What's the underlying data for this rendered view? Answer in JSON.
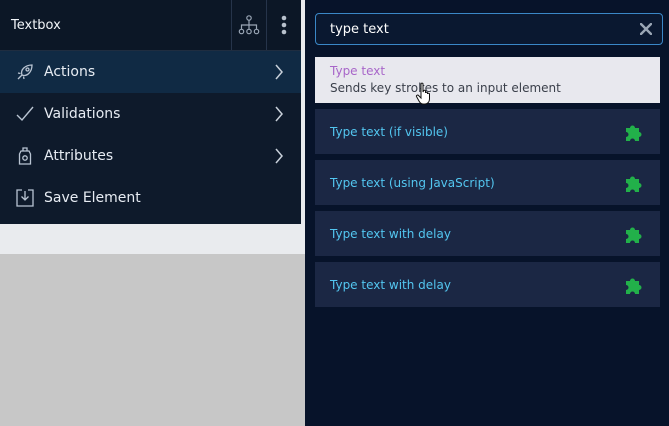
{
  "menu": {
    "title": "Textbox",
    "items": [
      {
        "label": "Actions",
        "icon": "rocket-icon",
        "active": true
      },
      {
        "label": "Validations",
        "icon": "checkmark-icon"
      },
      {
        "label": "Attributes",
        "icon": "tag-icon"
      },
      {
        "label": "Save Element",
        "icon": "save-download-icon"
      }
    ]
  },
  "search": {
    "value": "type text"
  },
  "results": [
    {
      "label": "Type text",
      "description": "Sends key strokes to an input element",
      "highlighted": true
    },
    {
      "label": "Type text (if visible)",
      "icon": "puzzle-icon"
    },
    {
      "label": "Type text (using JavaScript)",
      "icon": "puzzle-icon"
    },
    {
      "label": "Type text with delay",
      "icon": "puzzle-icon"
    },
    {
      "label": "Type text with delay",
      "icon": "puzzle-icon"
    }
  ],
  "colors": {
    "accent": "#53c6f0",
    "puzzle": "#22b04a",
    "highlight_title": "#a866c9",
    "panel_bg": "#07132a"
  }
}
